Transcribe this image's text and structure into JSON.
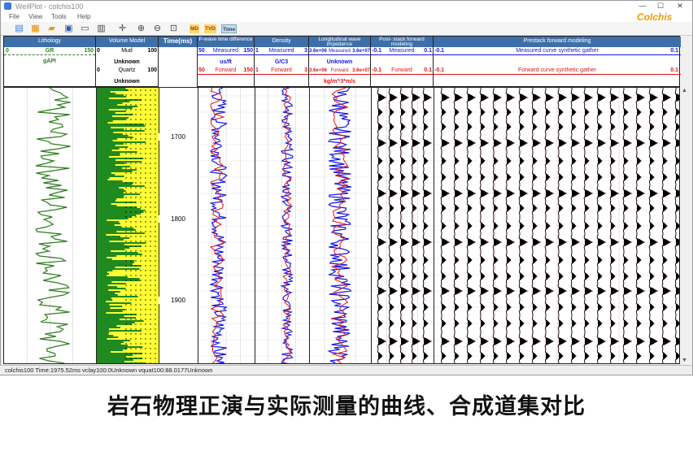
{
  "window": {
    "title": "WellPlot - colchis100",
    "min_glyph": "—",
    "max_glyph": "☐",
    "close_glyph": "✕"
  },
  "menu": [
    "File",
    "View",
    "Tools",
    "Help"
  ],
  "toolbar": {
    "md": "MD",
    "tvd": "TVD",
    "time": "Time"
  },
  "brand": "Colchis",
  "tracks": {
    "lithology": {
      "title": "Lithology",
      "min": "0",
      "curve": "GR",
      "max": "150",
      "unit": "gAPI"
    },
    "volume": {
      "title": "Volume Model",
      "r1_min": "0",
      "r1_name": "Mud",
      "r1_max": "100",
      "r2_name": "Unknown",
      "r3_min": "0",
      "r3_name": "Quartz",
      "r3_max": "100",
      "r4_name": "Unknown"
    },
    "time": {
      "title": "Time(ms)"
    },
    "pwave": {
      "title": "P-wave time difference",
      "min": "50",
      "name": "Measured",
      "max": "150",
      "unit": "us/ft",
      "min2": "50",
      "name2": "Forward",
      "max2": "150"
    },
    "density": {
      "title": "Density",
      "min": "1",
      "name": "Measured",
      "max": "3",
      "unit": "G/C3",
      "min2": "1",
      "name2": "Forward",
      "max2": "3"
    },
    "impedance": {
      "title": "Longitudinal wave impedance",
      "min": "3.6e+06",
      "name": "Measured",
      "max": "3.6e+07",
      "unit_top": "Unknown",
      "min2": "3.6e+06",
      "name2": "Forward",
      "max2": "3.6e+07",
      "unit": "kg/m^3*m/s"
    },
    "poststack": {
      "title": "Post- stack forward modeling",
      "min": "-0.1",
      "name": "Measured",
      "max": "0.1",
      "min2": "-0.1",
      "name2": "Forward",
      "max2": "0.1"
    },
    "prestack": {
      "title": "Prestack forward modeling",
      "min": "-0.1",
      "name": "Measured curve synthetic gather",
      "max": "0.1",
      "min2": "-0.1",
      "name2": "Forward curve synthetic gather",
      "max2": "0.1"
    }
  },
  "depth_labels": [
    "1700",
    "1800",
    "1900"
  ],
  "colors": {
    "header_blue": "#3e6fa8",
    "gr_green": "#2f7d1f",
    "measured_blue": "#1515e0",
    "forward_red": "#e01515",
    "sand_yellow": "#ffff33",
    "mud_green": "#2aa02a",
    "brand_orange": "#f29a00"
  },
  "status": "colchis100 Time:1975.52ms   vclay100:0Unknown   vquat100:88.0177Unknown",
  "caption": "岩石物理正演与实际测量的曲线、合成道集对比"
}
